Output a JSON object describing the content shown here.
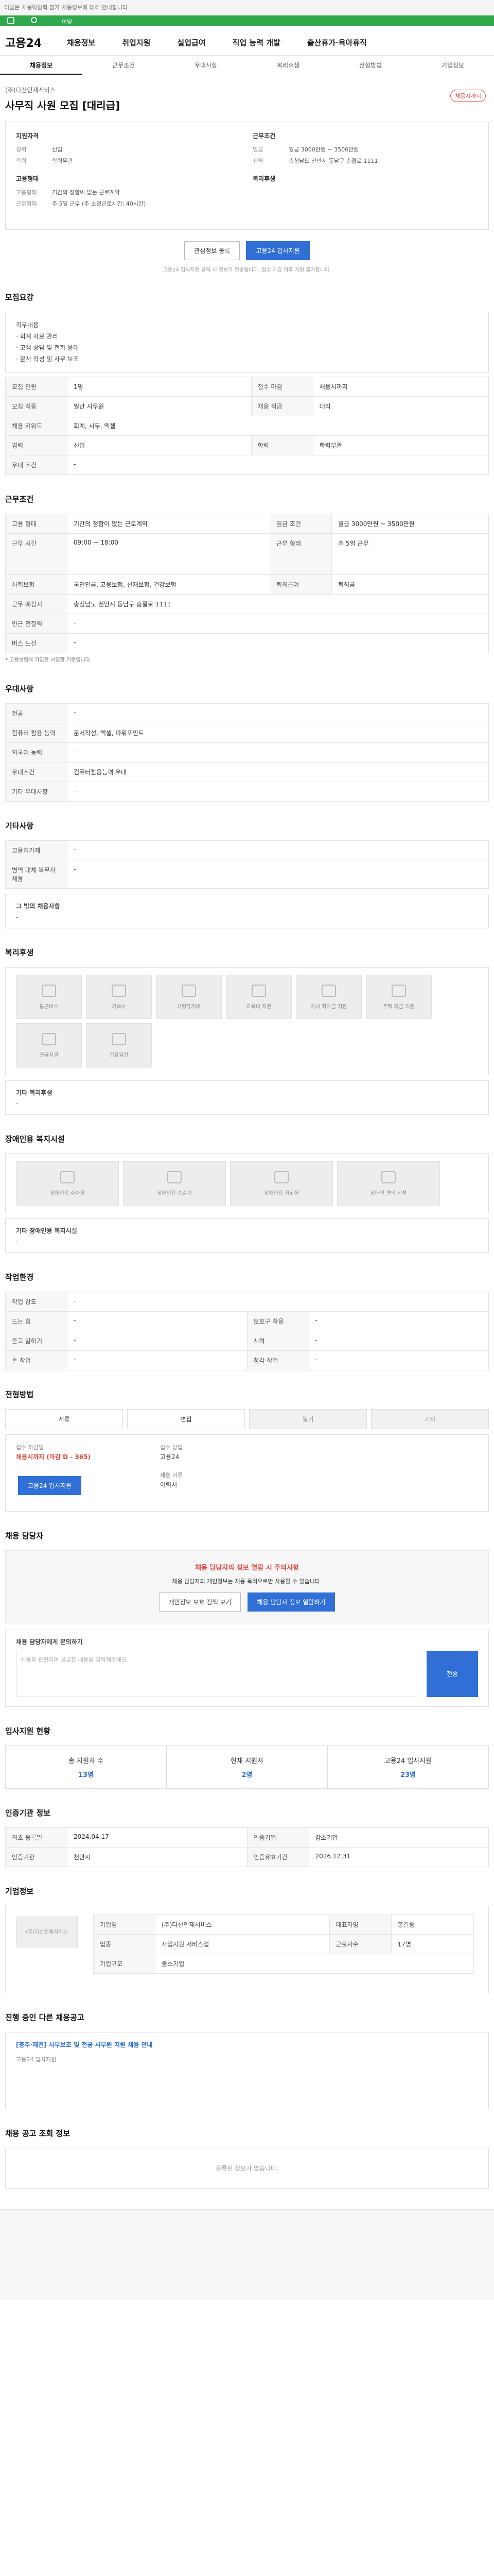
{
  "top": {
    "notice": "이달은 채용박람회 참가 채용정보에 대해 안내합니다",
    "green": "이달"
  },
  "header": {
    "logo": "고용24",
    "nav": [
      "채용정보",
      "취업지원",
      "실업급여",
      "직업 능력 개발",
      "출산휴가·육아휴직"
    ]
  },
  "tabs": [
    "채용정보",
    "근무조건",
    "우대사항",
    "복리후생",
    "전형방법",
    "기업정보"
  ],
  "job": {
    "company": "(주)다산인재서비스",
    "title": "사무직 사원 모집 [대리급]",
    "badge": "채용시까지",
    "cond_head": "지원자격",
    "cond": [
      [
        "경력",
        "신입"
      ],
      [
        "학력",
        "학력무관"
      ]
    ],
    "cond2_head": "근무조건",
    "cond2": [
      [
        "임금",
        "월급 3000만원 ~ 3500만원"
      ],
      [
        "지역",
        "충청남도 천안시 동남구 충절로 1111"
      ]
    ],
    "emp_head": "고용형태",
    "emp": [
      [
        "고용형태",
        "기간의 정함이 없는 근로계약"
      ],
      [
        "근무형태",
        "주 5일 근무 (주 소정근로시간: 40시간)"
      ]
    ],
    "welfare_head": "복리후생"
  },
  "buttons": {
    "save": "관심정보 등록",
    "apply": "고용24 입사지원"
  },
  "note_apply": "고용24 입사지원 클릭 시 정보가 전송됩니다. 접수 마감 이후 지원 불가합니다.",
  "s1": {
    "h": "모집요강",
    "body": [
      "직무내용",
      "· 회계 자료 관리",
      "· 고객 상담 및 전화 응대",
      "· 문서 작성 및 사무 보조"
    ],
    "rows": [
      [
        "모집 인원",
        "1명",
        "접수 마감",
        "채용시까지"
      ],
      [
        "모집 직종",
        "일반 사무원",
        "채용 직급",
        "대리"
      ],
      [
        "채용 키워드",
        "회계, 사무, 엑셀",
        "",
        ""
      ],
      [
        "경력",
        "신입",
        "학력",
        "학력무관"
      ],
      [
        "우대 조건",
        "-",
        "",
        ""
      ]
    ]
  },
  "s2": {
    "h": "근무조건",
    "rows": [
      [
        "고용 형태",
        "기간의 정함이 없는 근로계약",
        "임금 조건",
        "월급 3000만원 ~ 3500만원"
      ],
      [
        "근무 시간",
        "09:00 ~ 18:00",
        "근무 형태",
        "주 5일 근무"
      ],
      [
        "사회보험",
        "국민연금, 고용보험, 산재보험, 건강보험",
        "퇴직급여",
        "퇴직금"
      ],
      [
        "근무 예정지",
        "충청남도 천안시 동남구 충절로 1111",
        "",
        ""
      ],
      [
        "인근 전철역",
        "-",
        "",
        ""
      ],
      [
        "버스 노선",
        "-",
        "",
        ""
      ]
    ],
    "note": "* 고용보험에 가입한 사업장 기준입니다."
  },
  "s3": {
    "h": "우대사항",
    "rows": [
      [
        "전공",
        "-"
      ],
      [
        "컴퓨터 활용 능력",
        "문서작성, 엑셀, 파워포인트"
      ],
      [
        "외국어 능력",
        "-"
      ],
      [
        "우대조건",
        "컴퓨터활용능력 우대"
      ],
      [
        "기타 우대사항",
        "-"
      ]
    ]
  },
  "s4": {
    "h": "기타사항",
    "rows": [
      [
        "고용허가제",
        "-"
      ],
      [
        "병역 대체 복무자 채용",
        "-"
      ]
    ],
    "sub": "그 밖의 채용사항",
    "subv": "-"
  },
  "s5": {
    "h": "복리후생",
    "cards": [
      "통근버스",
      "기숙사",
      "차량유지비",
      "교육비 지원",
      "자녀 학자금 지원",
      "주택 자금 지원",
      "연금지원",
      "건강검진"
    ],
    "sub": "기타 복리후생",
    "subv": "-"
  },
  "s6": {
    "h": "장애인용 복지시설",
    "cards": [
      "장애인용 주차장",
      "장애인용 승강기",
      "장애인용 화장실",
      "장애인 편의 시설"
    ],
    "sub": "기타 장애인용 복지시설",
    "subv": "-"
  },
  "s7": {
    "h": "작업환경",
    "rows": [
      [
        "작업 강도",
        "-",
        "",
        ""
      ],
      [
        "드는 힘",
        "-",
        "보호구 착용",
        "-"
      ],
      [
        "듣고 말하기",
        "-",
        "시력",
        "-"
      ],
      [
        "손 작업",
        "-",
        "청각 작업",
        "-"
      ]
    ]
  },
  "s8": {
    "h": "전형방법",
    "sel": [
      "서류",
      "면접",
      "필기",
      "기타"
    ],
    "deadline_k": "접수 마감일",
    "deadline": "채용시까지 (마감 D - 365)",
    "method_k": "접수 방법",
    "method": "고용24",
    "docs_k": "제출 서류",
    "docs": "이력서",
    "apply": "고용24 입사지원"
  },
  "s9": {
    "h": "채용 담당자",
    "alert": "채용 담당자의 정보 열람 시 주의사항",
    "desc": "채용 담당자의 개인정보는 채용 목적으로만 사용할 수 있습니다.",
    "b1": "개인정보 보호 정책 보기",
    "b2": "채용 담당자 정보 열람하기",
    "ask": "채용 담당자에게 문의하기",
    "ph": "채용과 관련하여 궁금한 내용을 입력해주세요.",
    "send": "전송"
  },
  "s10": {
    "h": "입사지원 현황",
    "stats": [
      [
        "총 지원자 수",
        "13명"
      ],
      [
        "현재 지원자",
        "2명"
      ],
      [
        "고용24 입사지원",
        "23명"
      ]
    ]
  },
  "s11": {
    "h": "인증기관 정보",
    "rows": [
      [
        "최초 등록일",
        "2024.04.17",
        "인증기업",
        "강소기업"
      ],
      [
        "인증기관",
        "천안시",
        "인증유효기간",
        "2026.12.31"
      ]
    ]
  },
  "s12": {
    "h": "기업정보",
    "name": "(주)다산인재서비스",
    "rows": [
      [
        "기업명",
        "(주)다산인재서비스",
        "대표자명",
        "홍길동"
      ],
      [
        "업종",
        "사업지원 서비스업",
        "근로자수",
        "17명"
      ],
      [
        "기업규모",
        "중소기업",
        "",
        ""
      ]
    ]
  },
  "s13": {
    "h": "진행 중인 다른 채용공고",
    "item": "[충주·제천] 사무보조 및 전공 사무원 지원 채용 안내",
    "sub": "고용24 입사지원"
  },
  "s14": {
    "h": "채용 공고 조회 정보",
    "empty": "등록된 정보가 없습니다."
  }
}
